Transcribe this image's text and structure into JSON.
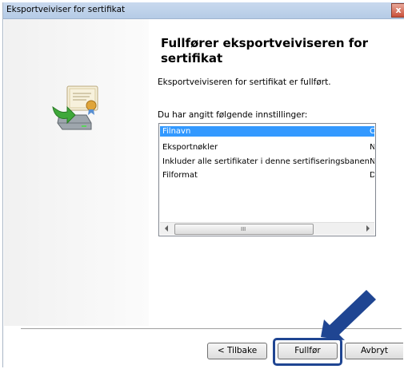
{
  "window": {
    "title": "Eksportveiviser for sertifikat",
    "close_glyph": "x"
  },
  "icons": {
    "wizard": "certificate-export-icon",
    "annotation": "blue-arrow-pointer"
  },
  "main": {
    "heading": "Fullfører eksportveiviseren for sertifikat",
    "description": "Eksportveiviseren for sertifikat er fullført.",
    "list_label": "Du har angitt følgende innstillinger:",
    "settings": [
      {
        "name": "Filnavn",
        "value": "C",
        "selected": true
      },
      {
        "name": "Eksportnøkler",
        "value": "N",
        "selected": false
      },
      {
        "name": "Inkluder alle sertifikater i denne sertifiseringsbanen",
        "value": "N",
        "selected": false
      },
      {
        "name": "Filformat",
        "value": "D",
        "selected": false
      }
    ],
    "scroll_grip": "III"
  },
  "buttons": {
    "back": "< Tilbake",
    "finish": "Fullfør",
    "cancel": "Avbryt"
  },
  "colors": {
    "selection": "#3399ff",
    "annotation_blue": "#1f4592",
    "titlebar": "#c9d9ee"
  }
}
